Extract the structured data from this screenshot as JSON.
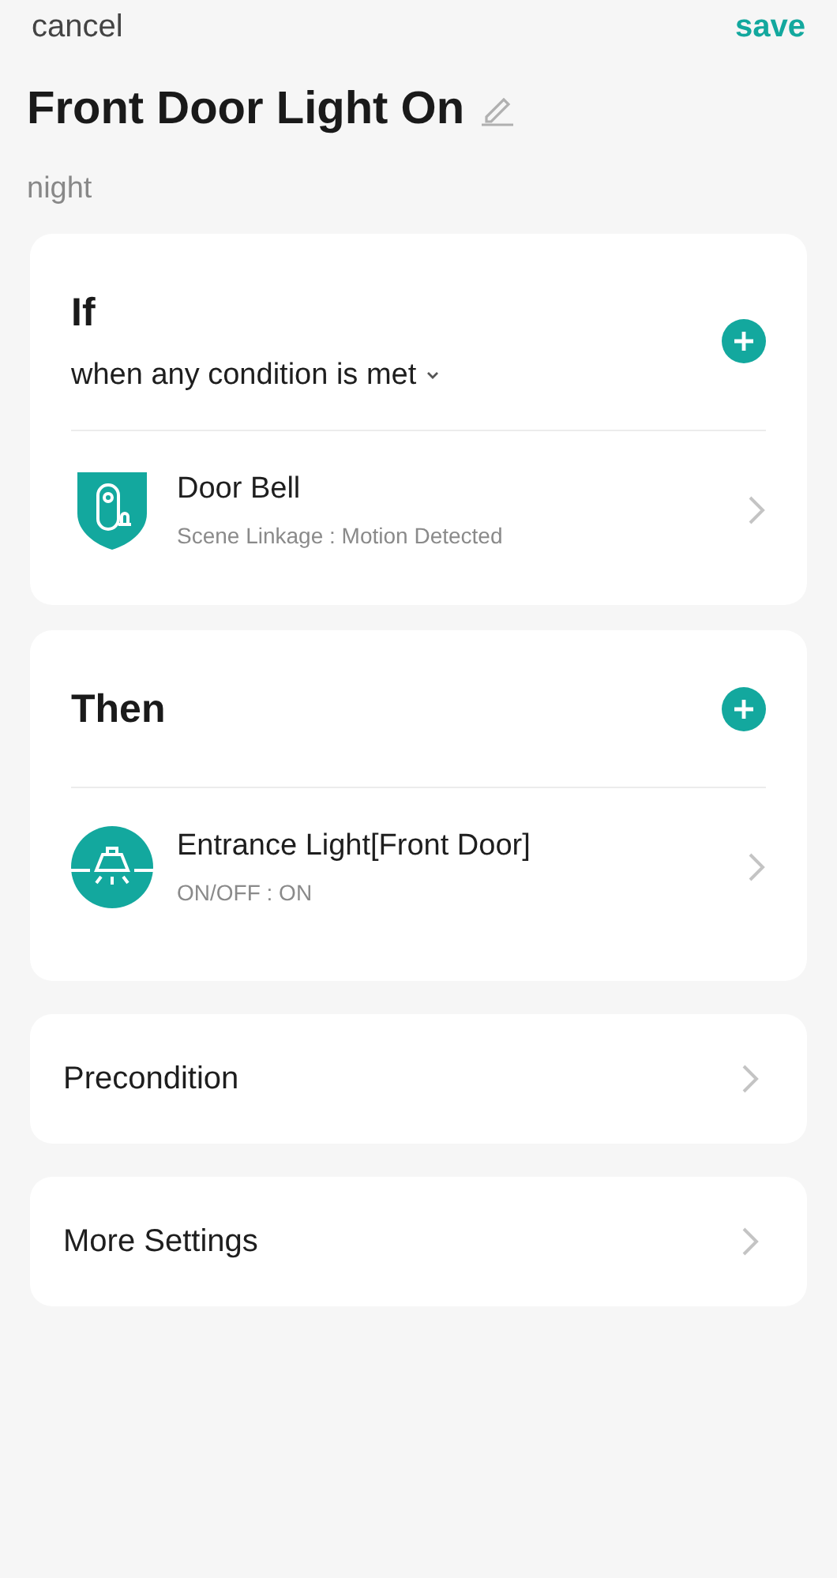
{
  "header": {
    "cancel": "cancel",
    "save": "save"
  },
  "scene": {
    "title": "Front Door Light On",
    "subtitle": "night"
  },
  "if_card": {
    "title": "If",
    "mode": "when any condition is met",
    "items": [
      {
        "kind": "doorbell",
        "name": "Door Bell",
        "detail": "Scene Linkage : Motion Detected"
      }
    ]
  },
  "then_card": {
    "title": "Then",
    "items": [
      {
        "kind": "light",
        "name": "Entrance Light[Front Door]",
        "detail": "ON/OFF : ON"
      }
    ]
  },
  "rows": [
    "Precondition",
    "More Settings"
  ]
}
